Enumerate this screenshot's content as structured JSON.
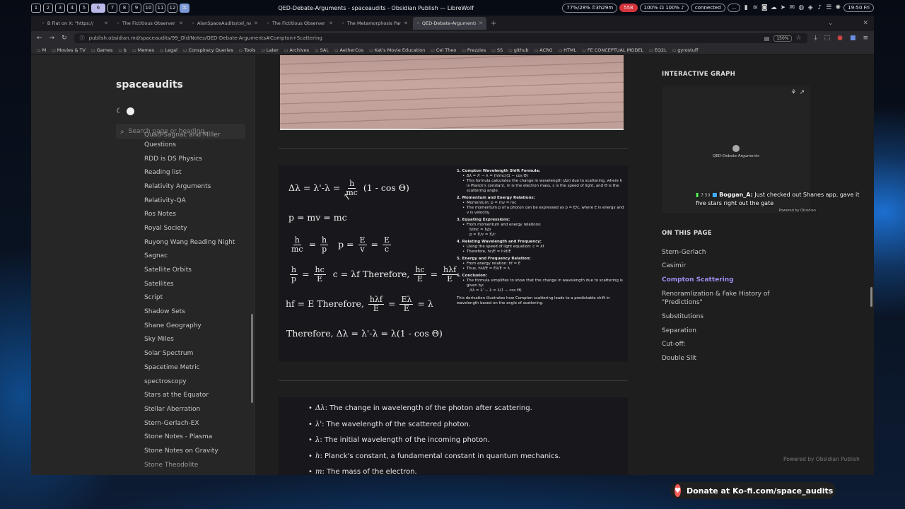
{
  "system_bar": {
    "workspaces": [
      "1",
      "2",
      "3",
      "4",
      "5",
      "6",
      "7",
      "8",
      "9",
      "10",
      "11",
      "12"
    ],
    "active_workspace": "6",
    "window_title": "QED-Debate-Arguments - spaceaudits - Obsidian Publish — LibreWolf",
    "battery": "77%/28% ⏱3h29m",
    "notification_count": "558",
    "volume": "100% ☊ 100% ♪",
    "network": "connected",
    "ellipsis": "...",
    "clock": "19:50 Fri"
  },
  "browser": {
    "tabs": [
      {
        "label": "B Fiat on X: \"https://",
        "active": false
      },
      {
        "label": "The Fictitious Observer at th",
        "active": false
      },
      {
        "label": "AlanSpaceAudits/cel_na",
        "active": false
      },
      {
        "label": "The Fictitious Observer at th",
        "active": false
      },
      {
        "label": "The Metamorphosis Parado",
        "active": false
      },
      {
        "label": "QED-Debate-Arguments",
        "active": true
      }
    ],
    "url": "publish.obsidian.md/spaceaudits/99_Old/Notes/QED-Debate-Arguments#Compton+Scattering",
    "zoom": "150%",
    "bookmarks": [
      "M",
      "Movies & TV",
      "Games",
      "$",
      "Memes",
      "Legal",
      "Conspiracy Queries",
      "Tools",
      "Later",
      "Archives",
      "SAL",
      "AetherCos",
      "Kat's Movie Education",
      "Cel Theo",
      "Prezzies",
      "SS",
      "github",
      "ACRG",
      "HTML",
      "FE CONCEPTUAL MODEL",
      "EQ2L",
      "gyrostuff"
    ]
  },
  "left_sidebar": {
    "site_name": "spaceaudits",
    "search_placeholder": "Search page or heading...",
    "nav_items": [
      "Quad-Sagnac and Miller",
      "Questions",
      "RDD is DS Physics",
      "Reading list",
      "Relativity Arguments",
      "Relativity-QA",
      "Ros Notes",
      "Royal Society",
      "Ruyong Wang Reading Night",
      "Sagnac",
      "Satellite Orbits",
      "Satellites",
      "Script",
      "Shadow Sets",
      "Shane Geography",
      "Sky Miles",
      "Solar Spectrum",
      "Spacetime Metric",
      "spectroscopy",
      "Stars at the Equator",
      "Stellar Aberration",
      "Stern-Gerlach-EX",
      "Stone Notes - Plasma",
      "Stone Notes on Gravity",
      "Stone Theodolite"
    ]
  },
  "formula_image": {
    "lines": {
      "l1_left": "Δλ = λ'-λ =",
      "l1_num": "h",
      "l1_den": "mc",
      "l1_right": "(1 - cos Θ)",
      "l2": "p = mv = mc",
      "l3_n1": "h",
      "l3_d1": "mc",
      "l3_eq": "=",
      "l3_n2": "h",
      "l3_d2": "p",
      "l3_p": "p =",
      "l3_n3": "E",
      "l3_d3": "v",
      "l3_eq2": "=",
      "l3_n4": "E",
      "l3_d4": "c",
      "l4_n1": "h",
      "l4_d1": "p",
      "l4_eq": "=",
      "l4_n2": "hc",
      "l4_d2": "E",
      "l4_mid": "c = λf  Therefore,",
      "l4_n3": "hc",
      "l4_d3": "E",
      "l4_eq2": "=",
      "l4_n4": "hλf",
      "l4_d4": "E",
      "l5_left": "hf = E  Therefore,",
      "l5_n1": "hλf",
      "l5_d1": "E",
      "l5_eq": "=",
      "l5_n2": "Eλ",
      "l5_d2": "E",
      "l5_right": "= λ",
      "l6": "Therefore,  Δλ = λ'-λ = λ(1 - cos Θ)"
    },
    "notes": {
      "s1_title": "1. Compton Wavelength Shift Formula:",
      "s1_b1": "Δλ = λ' − λ = (h/mc)(1 − cos Θ)",
      "s1_b2": "This formula calculates the change in wavelength (Δλ) due to scattering, where h is Planck's constant, m is the electron mass, c is the speed of light, and Θ is the scattering angle.",
      "s2_title": "2. Momentum and Energy Relations:",
      "s2_b1": "Momentum: p = mv = mc",
      "s2_b2": "The momentum p of a photon can be expressed as p = E/c, where E is energy and v is velocity.",
      "s3_title": "3. Equating Expressions:",
      "s3_b1": "From momentum and energy relations:",
      "s3_m1": "h/mc = h/p",
      "s3_m2": "p = E/v = E/c",
      "s4_title": "4. Relating Wavelength and Frequency:",
      "s4_b1": "Using the speed of light equation: c = λf",
      "s4_b2": "Therefore, hc/E = hλf/E",
      "s5_title": "5. Energy and Frequency Relation:",
      "s5_b1": "From energy relation: hf = E",
      "s5_b2": "Thus, hλf/E = Eλ/E = λ",
      "s6_title": "6. Conclusion:",
      "s6_b1": "The formula simplifies to show that the change in wavelength due to scattering is given by:",
      "s6_m1": "Δλ = λ' − λ = λ(1 − cos Θ)",
      "footer": "This derivation illustrates how Compton scattering leads to a predictable shift in wavelength based on the angle of scattering."
    }
  },
  "definitions": [
    {
      "sym": "Δλ",
      "text": ": The change in wavelength of the photon after scattering."
    },
    {
      "sym": "λ'",
      "text": ": The wavelength of the scattered photon."
    },
    {
      "sym": "λ",
      "text": ": The initial wavelength of the incoming photon."
    },
    {
      "sym": "h",
      "text": ": Planck's constant, a fundamental constant in quantum mechanics."
    },
    {
      "sym": "m",
      "text": ": The mass of the electron."
    }
  ],
  "right_sidebar": {
    "graph_heading": "INTERACTIVE GRAPH",
    "graph_node_label": "QED-Debate-Arguments",
    "toc_heading": "ON THIS PAGE",
    "toc_items": [
      "Stern-Gerlach",
      "Casimir",
      "Compton Scattering",
      "Renoramlization & Fake History of \"Predictions\"",
      "Substitutions",
      "Separation",
      "Cut-off:",
      "Double Slit"
    ],
    "toc_active": "Compton Scattering",
    "powered_by": "Powered by Obsidian Publish"
  },
  "chat_overlay": {
    "meta": "7:50",
    "user": "Boggan_A:",
    "message": "Just checked out Shanes app, gave it five stars right out the gate",
    "tiny": "Powered by Obsidian"
  },
  "kofi": {
    "label": "Donate at Ko-fi.com/space_audits"
  },
  "colors": {
    "accent": "#9f8cf0",
    "notification": "#d4333a",
    "kofi": "#ff5e5b"
  }
}
